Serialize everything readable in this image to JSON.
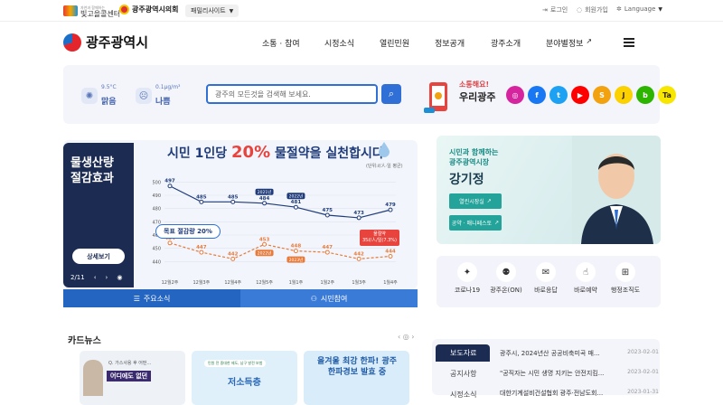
{
  "topbar": {
    "center_logo_small": "자연과 함께하는",
    "center_logo": "빛고을콜센터",
    "council": "광주광역시의회",
    "family_site": "패밀리사이트",
    "login": "로그인",
    "signup": "회원가입",
    "language": "Language"
  },
  "header": {
    "brand": "광주광역시",
    "nav": [
      "소통 · 참여",
      "시정소식",
      "열린민원",
      "정보공개",
      "광주소개",
      "분야별정보"
    ]
  },
  "weather": [
    {
      "label": "9.5°C",
      "value": "맑음"
    },
    {
      "label": "0.1μg/m³",
      "value": "나쁨"
    }
  ],
  "search": {
    "placeholder": "광주의 모든것을 검색해 보세요."
  },
  "sns": {
    "line1": "소통해요!",
    "line2": "우리광주",
    "items": [
      {
        "name": "instagram",
        "glyph": "◎",
        "color": "#d6249f"
      },
      {
        "name": "facebook",
        "glyph": "f",
        "color": "#1877f2"
      },
      {
        "name": "twitter",
        "glyph": "t",
        "color": "#1da1f2"
      },
      {
        "name": "youtube",
        "glyph": "▶",
        "color": "#ff0000"
      },
      {
        "name": "kakaostory",
        "glyph": "S",
        "color": "#f2a10f"
      },
      {
        "name": "kakaotalk",
        "glyph": "J",
        "color": "#fbd100"
      },
      {
        "name": "band",
        "glyph": "b",
        "color": "#2db400"
      },
      {
        "name": "kakao",
        "glyph": "Ta",
        "color": "#f7e600"
      }
    ]
  },
  "banner": {
    "side_title_1": "물생산량",
    "side_title_2": "절감효과",
    "more": "상세보기",
    "page": "2/11",
    "title_pre": "시민 1인당 ",
    "title_pct": "20%",
    "title_post": " 물절약을 실천합시다",
    "unit": "(단위:ℓ/人·일 평균)",
    "goal_badge": "목표 절감량 20%",
    "saving_badge_1": "물절약",
    "saving_badge_2": "35ℓ/人/일(7.3%)",
    "tabs": [
      "주요소식",
      "시민참여"
    ]
  },
  "chart_data": {
    "type": "line",
    "categories": [
      "12월2주",
      "12월3주",
      "12월4주",
      "12월5주",
      "1월1주",
      "1월2주",
      "1월3주",
      "1월4주"
    ],
    "series": [
      {
        "values": [
          497,
          485,
          485,
          484,
          481,
          475,
          473,
          479
        ]
      },
      {
        "values": [
          454,
          447,
          442,
          453,
          448,
          447,
          442,
          444
        ]
      }
    ],
    "annotations": [
      {
        "x": "12월5주",
        "text": "2021년"
      },
      {
        "x": "1월1주",
        "text": "2022년"
      },
      {
        "x": "12월5주",
        "text": "2022년"
      },
      {
        "x": "1월1주",
        "text": "2023년"
      }
    ],
    "ylim": [
      430,
      505
    ],
    "yticks": [
      440,
      450,
      460,
      470,
      480,
      490,
      500
    ],
    "grid": true
  },
  "mayor": {
    "line1": "시민과 함께하는",
    "line2": "광주광역시장",
    "name": "강기정",
    "btn1": "열린시장실",
    "btn2": "공약 · 매니페스토"
  },
  "quick": [
    "코로나19",
    "광주온(ON)",
    "바로응답",
    "바로예약",
    "행정조직도"
  ],
  "card_news": {
    "title": "카드뉴스",
    "cards": [
      {
        "top": "Q. 가스사용 후 어떤...",
        "main": "어디에도 없던"
      },
      {
        "top": "민원 전 중대한 제도, 남구 발전 보험",
        "main": "저소득층"
      },
      {
        "top": "",
        "main": "올겨울 최강 한파! 광주 한파경보 발효 중"
      }
    ]
  },
  "news": {
    "tabs": [
      "보도자료",
      "공지사항",
      "시정소식"
    ],
    "items": [
      {
        "title": "광주시, 2024년산 공공비축미곡 매...",
        "date": "2023-02-01"
      },
      {
        "title": "\"공직자는 시민 생명 지키는 안전지킴...",
        "date": "2023-02-01"
      },
      {
        "title": "대한기계설비건설협회 광주·전남도회...",
        "date": "2023-01-31"
      }
    ]
  }
}
